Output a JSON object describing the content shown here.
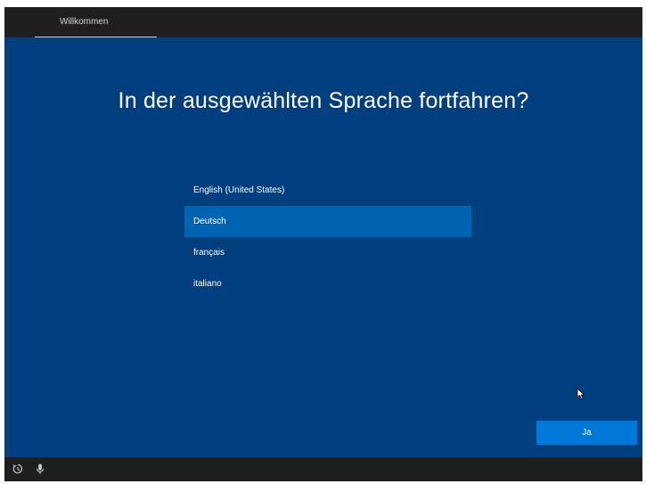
{
  "header": {
    "tab_label": "Willkommen"
  },
  "main": {
    "heading": "In der ausgewählten Sprache fortfahren?",
    "languages": [
      {
        "label": "English (United States)",
        "selected": false
      },
      {
        "label": "Deutsch",
        "selected": true
      },
      {
        "label": "français",
        "selected": false
      },
      {
        "label": "italiano",
        "selected": false
      }
    ],
    "yes_label": "Ja"
  },
  "footer": {
    "icons": [
      "ease-of-access-icon",
      "microphone-icon"
    ]
  },
  "colors": {
    "background": "#003e7e",
    "selected_item": "#0063b1",
    "button": "#0078d7",
    "bars": "#1f1f1f"
  }
}
